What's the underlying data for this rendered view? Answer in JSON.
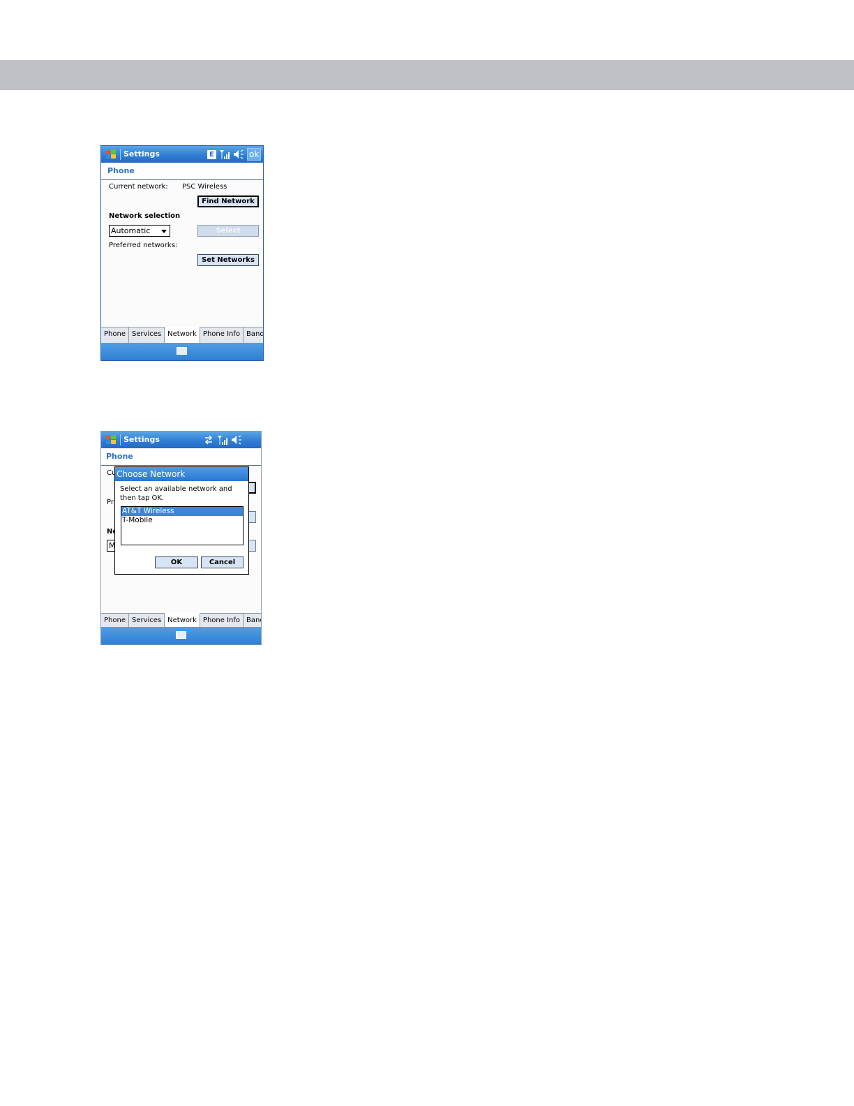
{
  "screen1": {
    "title": "Settings",
    "status_icons": [
      "e-icon",
      "signal-icon",
      "speaker-icon"
    ],
    "ok_label": "ok",
    "header": "Phone",
    "current_network_label": "Current network:",
    "current_network_value": "PSC Wireless",
    "find_network_button": "Find Network",
    "network_selection_label": "Network selection",
    "network_selection_value": "Automatic",
    "select_button": "Select",
    "preferred_networks_label": "Preferred networks:",
    "set_networks_button": "Set Networks",
    "tabs": [
      "Phone",
      "Services",
      "Network",
      "Phone Info",
      "Band"
    ],
    "active_tab": "Network"
  },
  "screen2": {
    "title": "Settings",
    "status_icons": [
      "data-arrows-icon",
      "signal-icon",
      "speaker-icon"
    ],
    "header": "Phone",
    "behind_labels": [
      "Cu",
      "Pr",
      "Ne",
      "M"
    ],
    "dialog": {
      "title": "Choose Network",
      "message": "Select an available network and then tap OK.",
      "networks": [
        "AT&T Wireless",
        "T-Mobile"
      ],
      "selected_network": "AT&T Wireless",
      "ok_button": "OK",
      "cancel_button": "Cancel"
    },
    "tabs": [
      "Phone",
      "Services",
      "Network",
      "Phone Info",
      "Band"
    ],
    "active_tab": "Network"
  }
}
